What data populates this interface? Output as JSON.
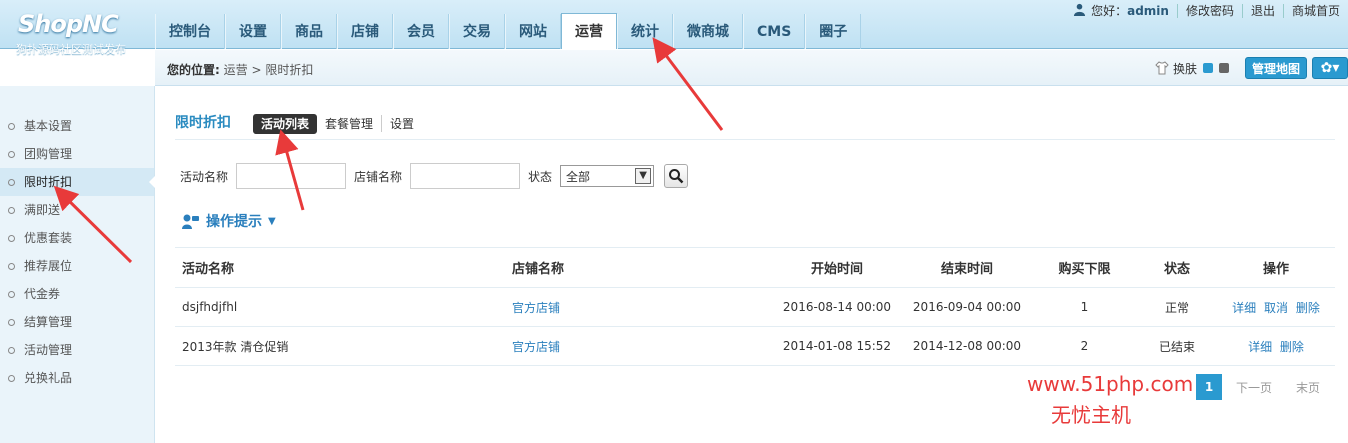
{
  "header": {
    "logo_main": "Shop",
    "logo_accent": "NC",
    "logo_sub": "狗扑源码社区测试发布",
    "nav": [
      "控制台",
      "设置",
      "商品",
      "店铺",
      "会员",
      "交易",
      "网站",
      "运营",
      "统计",
      "微商城",
      "CMS",
      "圈子"
    ],
    "active_nav": "运营",
    "topbar": {
      "greeting": "您好：",
      "username": "admin",
      "change_password": "修改密码",
      "logout": "退出",
      "store_home": "商城首页"
    }
  },
  "subheader": {
    "crumb_label": "您的位置:",
    "crumb_path": "运营 > 限时折扣",
    "skin_label": "换肤",
    "map_button": "管理地图",
    "colors": {
      "skin_blue": "#2a9ad0",
      "skin_gray": "#666666"
    }
  },
  "sidebar": {
    "items": [
      "基本设置",
      "团购管理",
      "限时折扣",
      "满即送",
      "优惠套装",
      "推荐展位",
      "代金券",
      "结算管理",
      "活动管理",
      "兑换礼品"
    ],
    "active": "限时折扣"
  },
  "main": {
    "title": "限时折扣",
    "tabs": [
      "活动列表",
      "套餐管理",
      "设置"
    ],
    "active_tab": "活动列表",
    "search": {
      "activity_name_label": "活动名称",
      "activity_name_value": "",
      "store_name_label": "店铺名称",
      "store_name_value": "",
      "status_label": "状态",
      "status_selected": "全部"
    },
    "tips_label": "操作提示",
    "table": {
      "columns": [
        "活动名称",
        "店铺名称",
        "开始时间",
        "结束时间",
        "购买下限",
        "状态",
        "操作"
      ],
      "rows": [
        {
          "name": "dsjfhdjfhl",
          "store": "官方店铺",
          "start": "2016-08-14 00:00",
          "end": "2016-09-04 00:00",
          "min": "1",
          "status": "正常",
          "actions": [
            "详细",
            "取消",
            "删除"
          ]
        },
        {
          "name": "2013年款 清仓促销",
          "store": "官方店铺",
          "start": "2014-01-08 15:52",
          "end": "2014-12-08 00:00",
          "min": "2",
          "status": "已结束",
          "actions": [
            "详细",
            "删除"
          ]
        }
      ]
    },
    "pager": {
      "current": "1",
      "next": "下一页",
      "last": "末页"
    }
  },
  "watermark": {
    "line1": "www.51php.com",
    "line2": "无忧主机"
  },
  "colors": {
    "accent": "#2a9ad0",
    "link": "#2a7fbd",
    "arrow": "#e83a3a"
  }
}
